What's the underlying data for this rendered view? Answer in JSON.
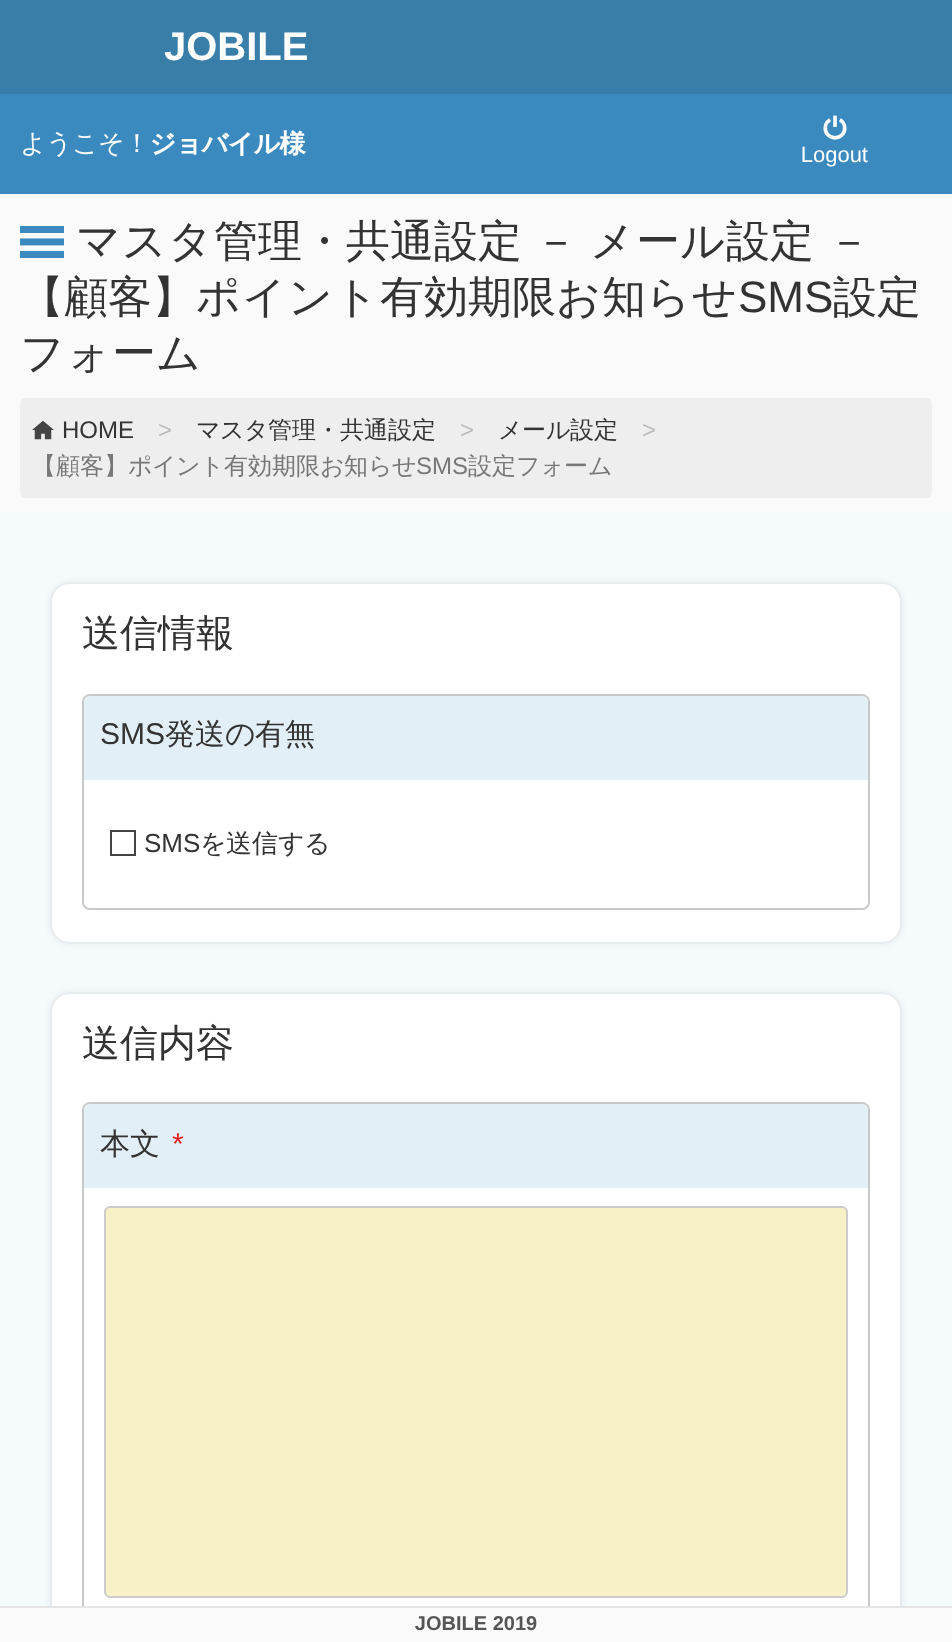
{
  "header": {
    "logo": "JOBILE"
  },
  "user_bar": {
    "greeting": "ようこそ！",
    "user_name": "ジョバイル様",
    "logout_label": "Logout"
  },
  "page_title": "マスタ管理・共通設定 － メール設定 －【顧客】ポイント有効期限お知らせSMS設定フォーム",
  "breadcrumb": [
    {
      "label": "HOME",
      "current": false
    },
    {
      "separator": ">",
      "label": "マスタ管理・共通設定",
      "current": false
    },
    {
      "separator": ">",
      "label": "メール設定",
      "current": false
    },
    {
      "separator": ">",
      "label": "【顧客】ポイント有効期限お知らせSMS設定フォーム",
      "current": true
    }
  ],
  "sections": [
    {
      "title": "送信情報",
      "field": {
        "kind": "checkbox",
        "label": "SMS発送の有無",
        "option": {
          "label": "SMSを送信する",
          "checked": false
        }
      }
    },
    {
      "title": "送信内容",
      "field": {
        "kind": "textarea",
        "label": "本文",
        "required_mark": "*"
      }
    }
  ],
  "footer": {
    "text": "JOBILE 2019"
  }
}
